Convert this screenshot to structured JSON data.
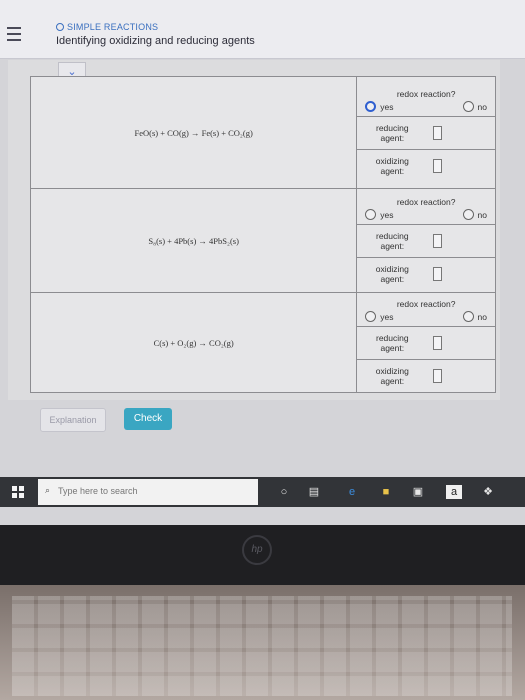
{
  "header": {
    "subtitle": "SIMPLE REACTIONS",
    "title": "Identifying oxidizing and reducing agents"
  },
  "collapse_glyph": "chevron-down-icon",
  "problems": [
    {
      "equation": "FeO(s) + CO(g) → Fe(s) + CO₂(g)",
      "redox_label": "redox reaction?",
      "yes_label": "yes",
      "no_label": "no",
      "yes_selected": true,
      "reducing_label_1": "reducing",
      "reducing_label_2": "agent:",
      "oxidizing_label_1": "oxidizing",
      "oxidizing_label_2": "agent:"
    },
    {
      "equation": "S₈(s) + 4Pb(s) → 4PbS₂(s)",
      "redox_label": "redox reaction?",
      "yes_label": "yes",
      "no_label": "no",
      "yes_selected": false,
      "reducing_label_1": "reducing",
      "reducing_label_2": "agent:",
      "oxidizing_label_1": "oxidizing",
      "oxidizing_label_2": "agent:"
    },
    {
      "equation": "C(s) + O₂(g) → CO₂(g)",
      "redox_label": "redox reaction?",
      "yes_label": "yes",
      "no_label": "no",
      "yes_selected": false,
      "reducing_label_1": "reducing",
      "reducing_label_2": "agent:",
      "oxidizing_label_1": "oxidizing",
      "oxidizing_label_2": "agent:"
    }
  ],
  "buttons": {
    "explanation": "Explanation",
    "check": "Check"
  },
  "taskbar": {
    "search_placeholder": "Type here to search",
    "icons": [
      "windows-icon",
      "search-icon",
      "cortana-icon",
      "task-view-icon",
      "edge-icon",
      "file-explorer-icon",
      "store-icon",
      "amazon-icon",
      "dropbox-icon"
    ]
  },
  "colors": {
    "accent": "#2f5fd0",
    "check_button": "#3aa6c2",
    "taskbar": "#323438"
  }
}
